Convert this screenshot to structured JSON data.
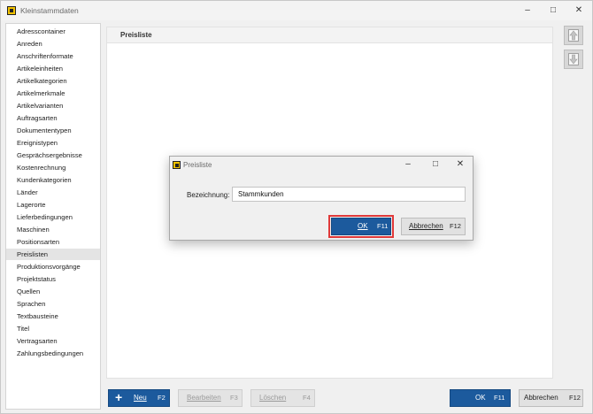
{
  "window": {
    "title": "Kleinstammdaten"
  },
  "sidebar": {
    "items": [
      {
        "label": "Adresscontainer"
      },
      {
        "label": "Anreden"
      },
      {
        "label": "Anschriftenformate"
      },
      {
        "label": "Artikeleinheiten"
      },
      {
        "label": "Artikelkategorien"
      },
      {
        "label": "Artikelmerkmale"
      },
      {
        "label": "Artikelvarianten"
      },
      {
        "label": "Auftragsarten"
      },
      {
        "label": "Dokumententypen"
      },
      {
        "label": "Ereignistypen"
      },
      {
        "label": "Gesprächsergebnisse"
      },
      {
        "label": "Kostenrechnung"
      },
      {
        "label": "Kundenkategorien"
      },
      {
        "label": "Länder"
      },
      {
        "label": "Lagerorte"
      },
      {
        "label": "Lieferbedingungen"
      },
      {
        "label": "Maschinen"
      },
      {
        "label": "Positionsarten"
      },
      {
        "label": "Preislisten"
      },
      {
        "label": "Produktionsvorgänge"
      },
      {
        "label": "Projektstatus"
      },
      {
        "label": "Quellen"
      },
      {
        "label": "Sprachen"
      },
      {
        "label": "Textbausteine"
      },
      {
        "label": "Titel"
      },
      {
        "label": "Vertragsarten"
      },
      {
        "label": "Zahlungsbedingungen"
      }
    ],
    "selected": "Preislisten"
  },
  "content": {
    "header": "Preisliste"
  },
  "toolbar": {
    "neu": {
      "label": "Neu",
      "key": "F2"
    },
    "bearbeiten": {
      "label": "Bearbeiten",
      "key": "F3"
    },
    "loeschen": {
      "label": "Löschen",
      "key": "F4"
    },
    "ok": {
      "label": "OK",
      "key": "F11"
    },
    "abbrechen": {
      "label": "Abbrechen",
      "key": "F12"
    }
  },
  "dialog": {
    "title": "Preisliste",
    "field_label": "Bezeichnung:",
    "field_value": "Stammkunden",
    "ok": {
      "label": "OK",
      "key": "F11"
    },
    "abbrechen": {
      "label": "Abbrechen",
      "key": "F12"
    }
  },
  "colors": {
    "accent": "#1c5a9d",
    "highlight": "#e03a3a",
    "selection": "#e4e4e4"
  },
  "icons": {
    "minimize": "minimize-icon",
    "maximize": "maximize-icon",
    "close": "close-icon",
    "move_up": "arrow-up-icon",
    "move_down": "arrow-down-icon",
    "add": "plus-icon"
  }
}
